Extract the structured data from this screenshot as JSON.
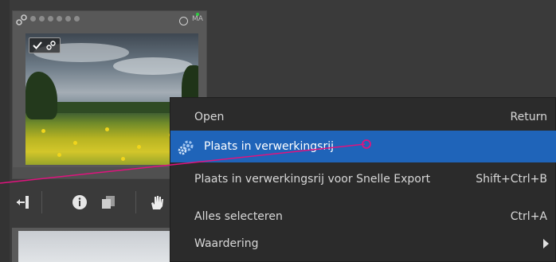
{
  "thumbnail": {
    "rating_stars": 6,
    "badge_text": "MA",
    "colors": {
      "badge_dot": "#2ecc40",
      "stars": "#8b8b8b"
    }
  },
  "toolbar": {
    "icons": [
      "adjust-icon",
      "info-icon",
      "copy-icon",
      "hand-icon"
    ]
  },
  "context_menu": {
    "items": [
      {
        "label": "Open",
        "shortcut": "Return"
      },
      {
        "label": "Plaats in verwerkingsrij",
        "shortcut": "",
        "highlighted": true,
        "icon": "gear-icon"
      },
      {
        "label": "Plaats in verwerkingsrij voor Snelle Export",
        "shortcut": "Shift+Ctrl+B"
      },
      {
        "label": "Alles selecteren",
        "shortcut": "Ctrl+A"
      },
      {
        "label": "Waardering",
        "shortcut": "",
        "submenu": true
      }
    ],
    "colors": {
      "highlight": "#1f64b9",
      "background": "#2b2b2b"
    }
  },
  "annotation": {
    "color": "#e0137e"
  }
}
